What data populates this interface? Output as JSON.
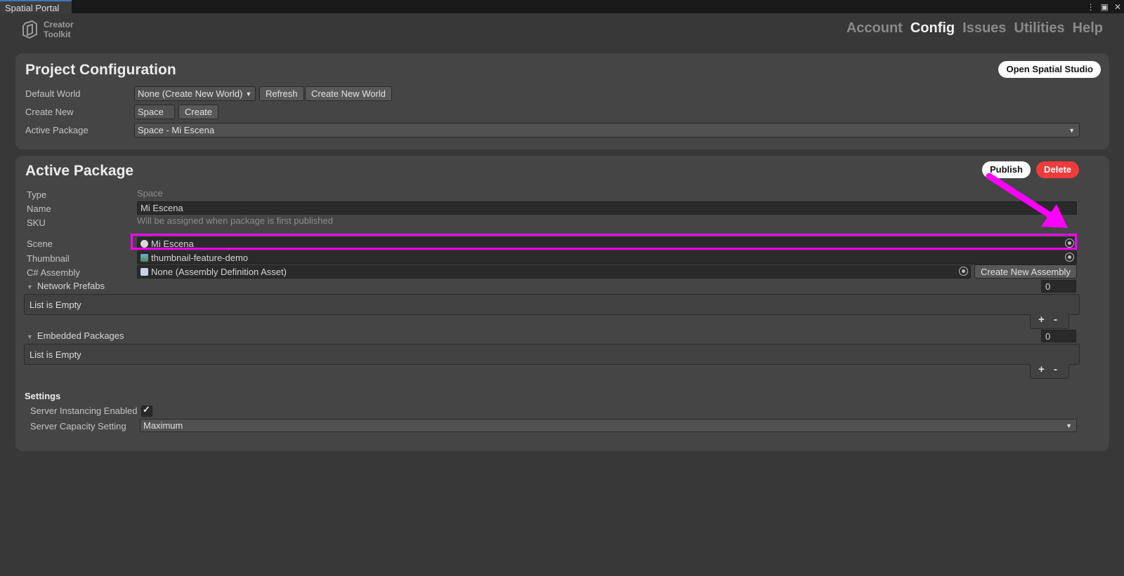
{
  "window": {
    "tab_title": "Spatial Portal"
  },
  "logo": {
    "line1": "Creator",
    "line2": "Toolkit"
  },
  "nav": {
    "account": "Account",
    "config": "Config",
    "issues": "Issues",
    "utilities": "Utilities",
    "help": "Help",
    "active": "Config"
  },
  "project_config": {
    "title": "Project Configuration",
    "open_studio_label": "Open Spatial Studio",
    "default_world_label": "Default World",
    "default_world_value": "None (Create New World)",
    "refresh_label": "Refresh",
    "create_new_world_label": "Create New World",
    "create_new_label": "Create New",
    "create_new_value": "Space",
    "create_label": "Create",
    "active_package_label": "Active Package",
    "active_package_value": "Space - Mi Escena"
  },
  "active_package": {
    "title": "Active Package",
    "publish_label": "Publish",
    "delete_label": "Delete",
    "type_label": "Type",
    "type_value": "Space",
    "name_label": "Name",
    "name_value": "Mi Escena",
    "sku_label": "SKU",
    "sku_value": "Will be assigned when package is first published",
    "scene_label": "Scene",
    "scene_value": "Mi Escena",
    "thumbnail_label": "Thumbnail",
    "thumbnail_value": "thumbnail-feature-demo",
    "assembly_label": "C# Assembly",
    "assembly_value": "None (Assembly Definition Asset)",
    "create_assembly_label": "Create New Assembly",
    "network_prefabs": {
      "label": "Network Prefabs",
      "count": "0",
      "empty_text": "List is Empty"
    },
    "embedded_packages": {
      "label": "Embedded Packages",
      "count": "0",
      "empty_text": "List is Empty"
    },
    "settings_title": "Settings",
    "server_instancing_label": "Server Instancing Enabled",
    "server_instancing_checked": true,
    "server_capacity_label": "Server Capacity Setting",
    "server_capacity_value": "Maximum"
  },
  "colors": {
    "highlight": "#ff00ff",
    "publish_bg": "#ffffff",
    "delete_bg": "#ee3b3b"
  }
}
